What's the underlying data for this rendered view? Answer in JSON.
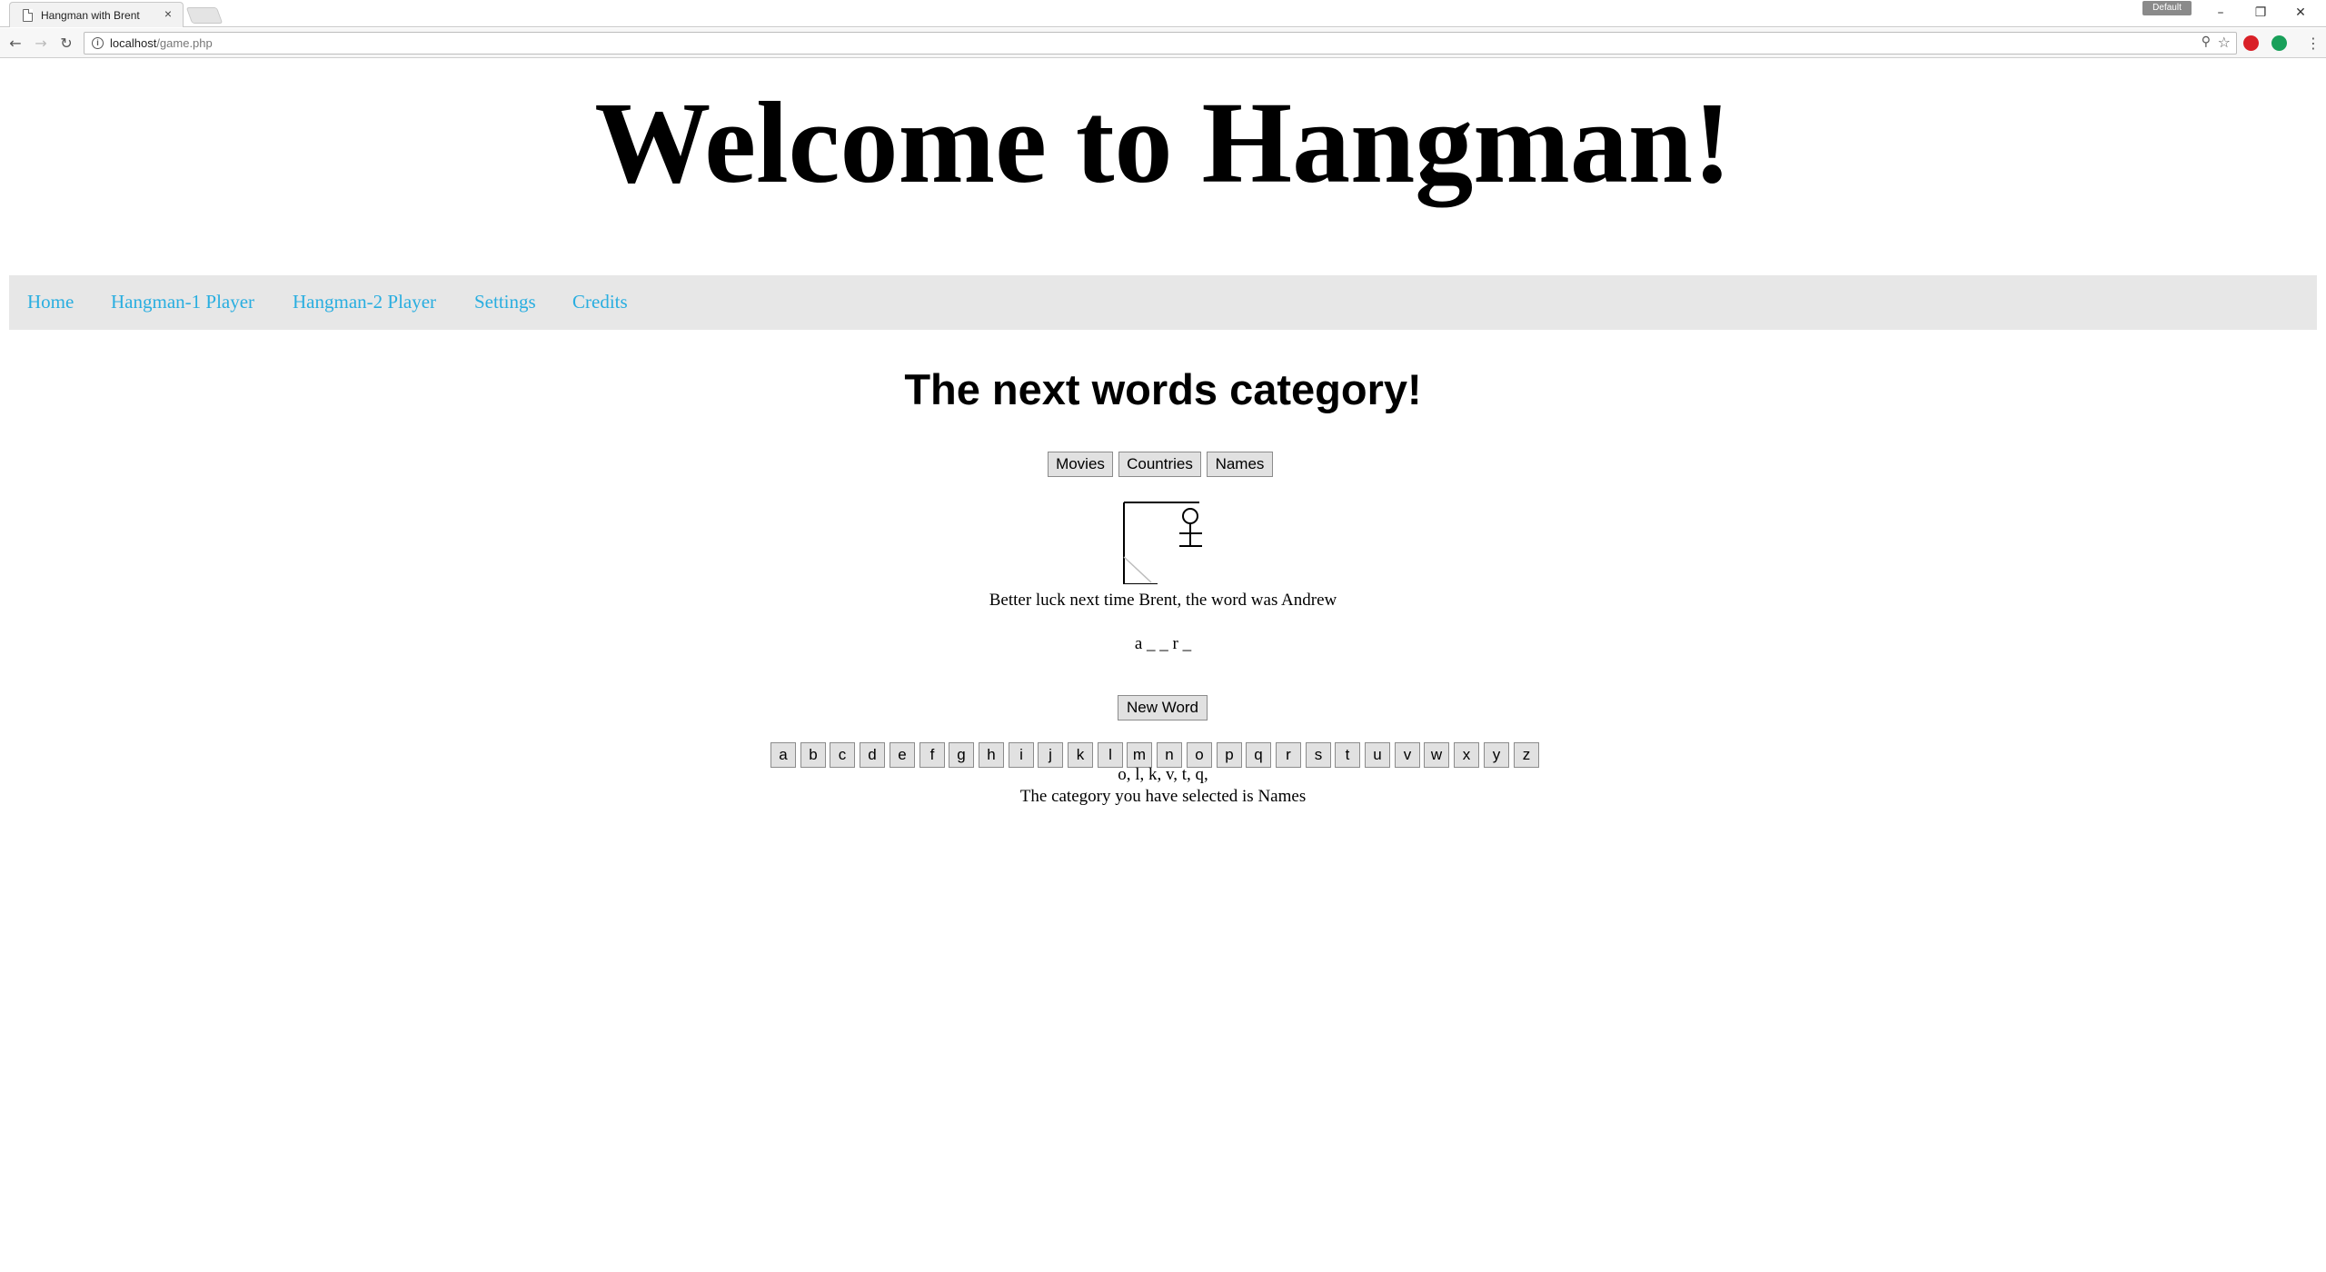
{
  "browser": {
    "tab_title": "Hangman with Brent",
    "tab_close": "×",
    "profile_badge": "Default",
    "window_controls": {
      "minimize": "–",
      "restore": "❐",
      "close": "✕"
    },
    "nav": {
      "back": "←",
      "forward": "→",
      "reload": "↻"
    },
    "url_host": "localhost",
    "url_path": "/game.php",
    "icons": {
      "zoom": "zoom-icon",
      "star": "bookmark-star-icon",
      "ext1": "extension-red-icon",
      "ext2": "extension-green-icon",
      "menu": "kebab-menu-icon"
    },
    "ext_colors": {
      "red": "#d92027",
      "green": "#19a05a"
    }
  },
  "page": {
    "title": "Welcome to Hangman!",
    "nav_links": [
      "Home",
      "Hangman-1 Player",
      "Hangman-2 Player",
      "Settings",
      "Credits"
    ],
    "link_color": "#29aee0",
    "category_heading": "The next words category!",
    "category_buttons": [
      "Movies",
      "Countries",
      "Names"
    ],
    "result_message": "Better luck next time Brent, the word was Andrew",
    "word_display": "a _ _ r _",
    "new_word_button": "New Word",
    "letters": [
      "a",
      "b",
      "c",
      "d",
      "e",
      "f",
      "g",
      "h",
      "i",
      "j",
      "k",
      "l",
      "m",
      "n",
      "o",
      "p",
      "q",
      "r",
      "s",
      "t",
      "u",
      "v",
      "w",
      "x",
      "y",
      "z"
    ],
    "guessed_letters": "o, l, k, v, t, q,",
    "selected_category_text": "The category you have selected is Names"
  }
}
